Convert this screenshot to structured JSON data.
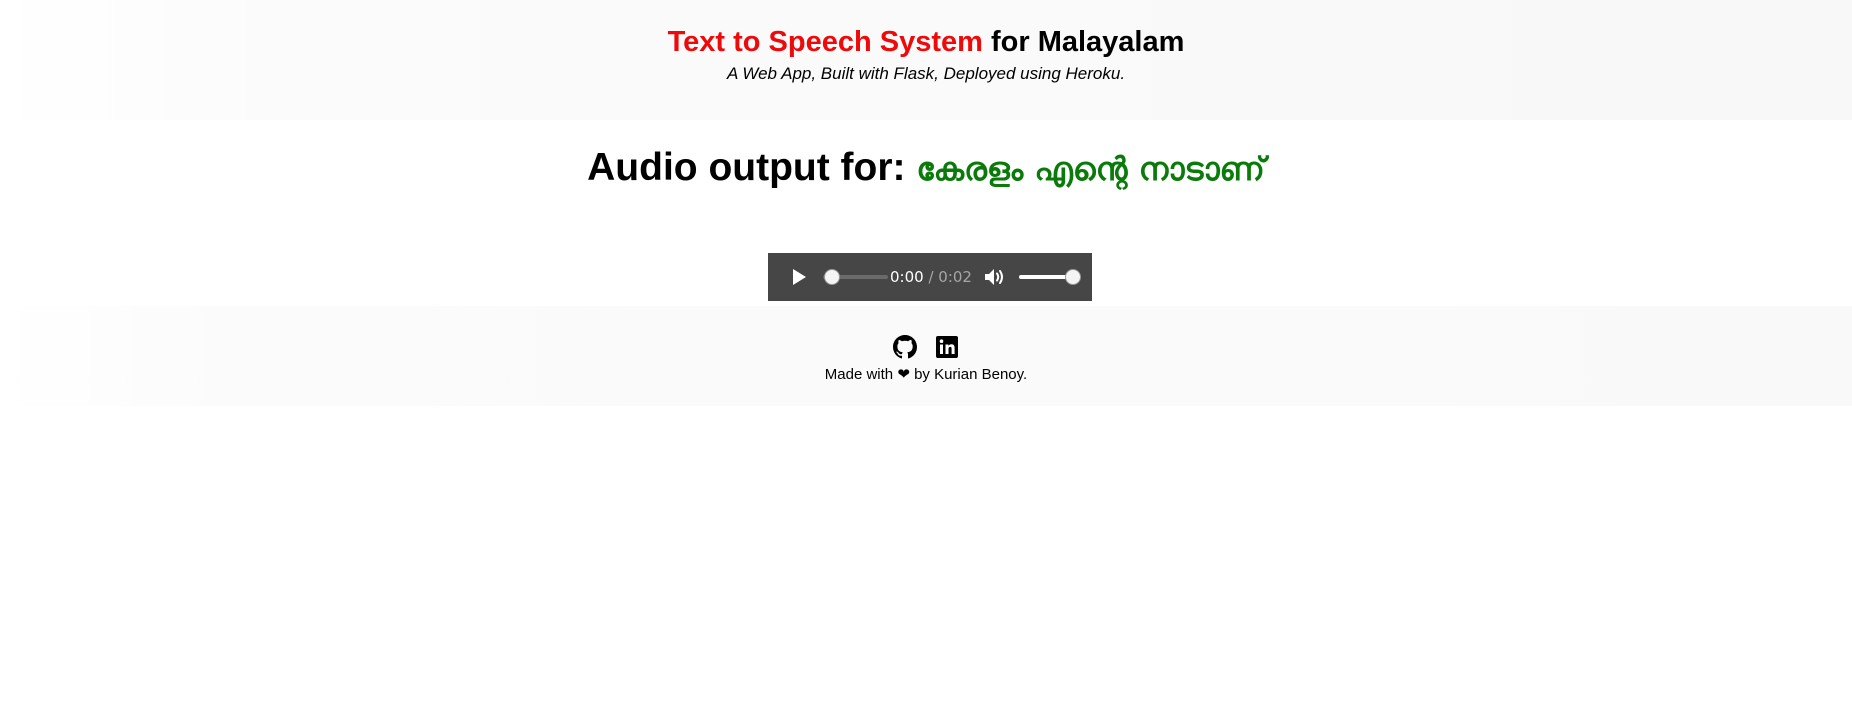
{
  "header": {
    "title_accent": "Text to Speech System",
    "title_rest": " for Malayalam",
    "subtitle": "A Web App, Built with Flask, Deployed using Heroku.",
    "accent_color": "#ee0a0a"
  },
  "output": {
    "heading_label": "Audio output for: ",
    "input_text": "കേരളം എന്റെ നാടാണ്",
    "text_color": "#0a7a0a"
  },
  "player": {
    "current_time": "0:00",
    "separator": " / ",
    "duration": "0:02",
    "progress": 0.0,
    "volume": 1.0,
    "play_icon": "play-icon",
    "volume_icon": "volume-icon",
    "background": "#464646"
  },
  "footer": {
    "links": [
      {
        "icon": "github-icon"
      },
      {
        "icon": "linkedin-icon"
      }
    ],
    "credit_prefix": "Made with ",
    "credit_heart": "❤",
    "credit_suffix": " by Kurian Benoy."
  }
}
